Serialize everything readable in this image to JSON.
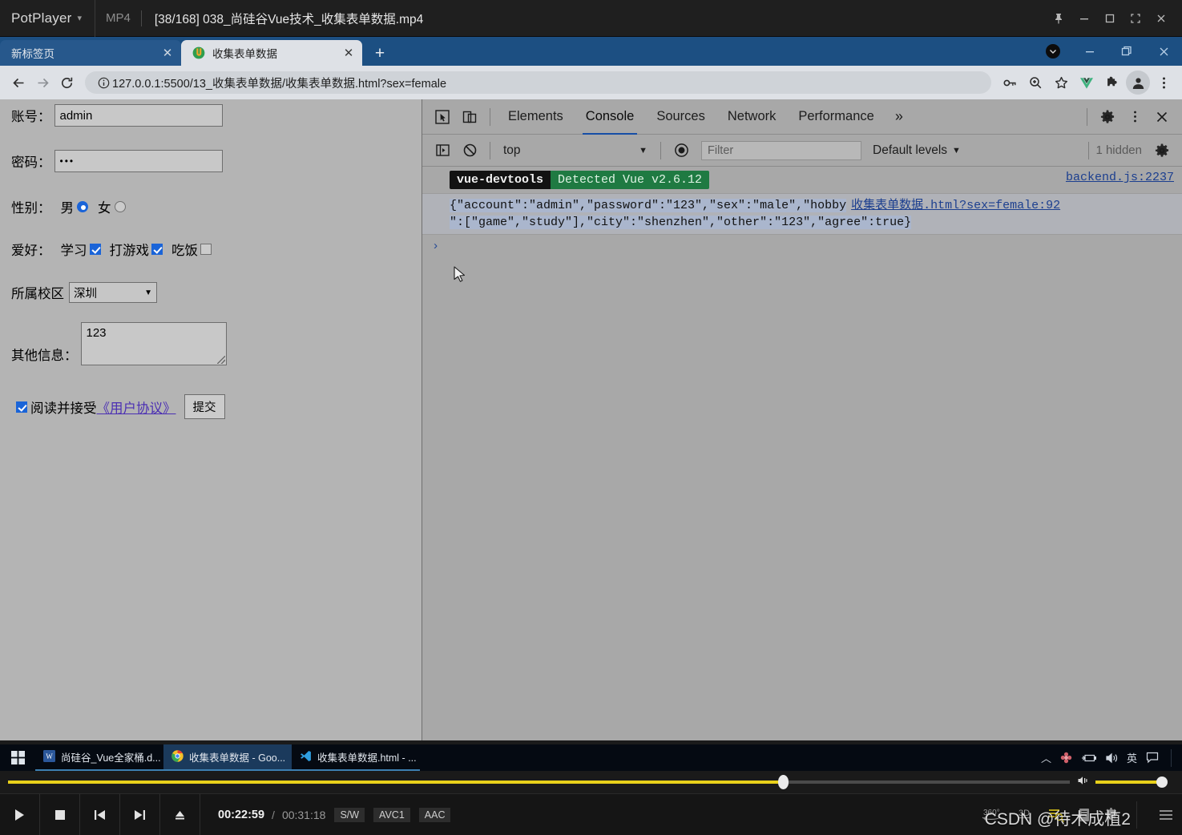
{
  "potplayer": {
    "app_name": "PotPlayer",
    "format": "MP4",
    "file_title": "[38/168] 038_尚硅谷Vue技术_收集表单数据.mp4",
    "window_buttons": [
      "pin",
      "minimize",
      "maximize",
      "fullscreen",
      "close"
    ],
    "time_current": "00:22:59",
    "time_separator": "/",
    "time_total": "00:31:18",
    "codec_tags": [
      "S/W",
      "AVC1",
      "AAC"
    ],
    "seek_percent": 73,
    "volume_percent": 100,
    "right_controls": [
      "360°",
      "3D"
    ],
    "watermark": "CSDN @待木成植2"
  },
  "chrome": {
    "tabs": [
      {
        "title": "新标签页",
        "active": false
      },
      {
        "title": "收集表单数据",
        "active": true
      }
    ],
    "new_tab_label": "+",
    "url": "127.0.0.1:5500/13_收集表单数据/收集表单数据.html?sex=female",
    "toolbar_icons": [
      "back-arrow",
      "forward-arrow",
      "reload",
      "site-info",
      "password-key",
      "zoom",
      "bookmark-star",
      "vue-devtools",
      "extensions-puzzle",
      "profile-avatar",
      "chrome-menu"
    ]
  },
  "page_form": {
    "account_label": "账号：",
    "account_value": "admin",
    "password_label": "密码：",
    "password_value": "•••",
    "sex_label": "性别：",
    "sex_options": [
      {
        "label": "男",
        "checked": true
      },
      {
        "label": "女",
        "checked": false
      }
    ],
    "hobby_label": "爱好：",
    "hobby_options": [
      {
        "label": "学习",
        "checked": true
      },
      {
        "label": "打游戏",
        "checked": true
      },
      {
        "label": "吃饭",
        "checked": false
      }
    ],
    "city_label": "所属校区",
    "city_value": "深圳",
    "other_label": "其他信息：",
    "other_value": "123",
    "agree_checked": true,
    "agree_text": "阅读并接受",
    "agree_link": "《用户协议》",
    "submit_label": "提交"
  },
  "devtools": {
    "panels": [
      "Elements",
      "Console",
      "Sources",
      "Network",
      "Performance"
    ],
    "active_panel": "Console",
    "more_panels_label": "»",
    "context_value": "top",
    "filter_placeholder": "Filter",
    "levels_label": "Default levels",
    "hidden_label": "1 hidden",
    "messages": [
      {
        "badge_left": "vue-devtools",
        "badge_right": "Detected Vue v2.6.12",
        "source": "backend.js:2237"
      },
      {
        "text_part1": "{\"account\":\"admin\",\"password\":\"123\",\"sex\":\"male\",\"hobby",
        "source": "收集表单数据.html?sex=female:92",
        "text_part2": "\":[\"game\",\"study\"],\"city\":\"shenzhen\",\"other\":\"123\",\"agree\":true}"
      }
    ],
    "prompt_caret": "›"
  },
  "taskbar": {
    "items": [
      {
        "title": "尚硅谷_Vue全家桶.d...",
        "icon": "word-icon",
        "active": false
      },
      {
        "title": "收集表单数据 - Goo...",
        "icon": "chrome-icon",
        "active": true
      },
      {
        "title": "收集表单数据.html - ...",
        "icon": "vscode-icon",
        "active": false
      }
    ],
    "tray": [
      "chevron-up",
      "flower",
      "plug-battery",
      "speaker",
      "英",
      "notification"
    ]
  }
}
